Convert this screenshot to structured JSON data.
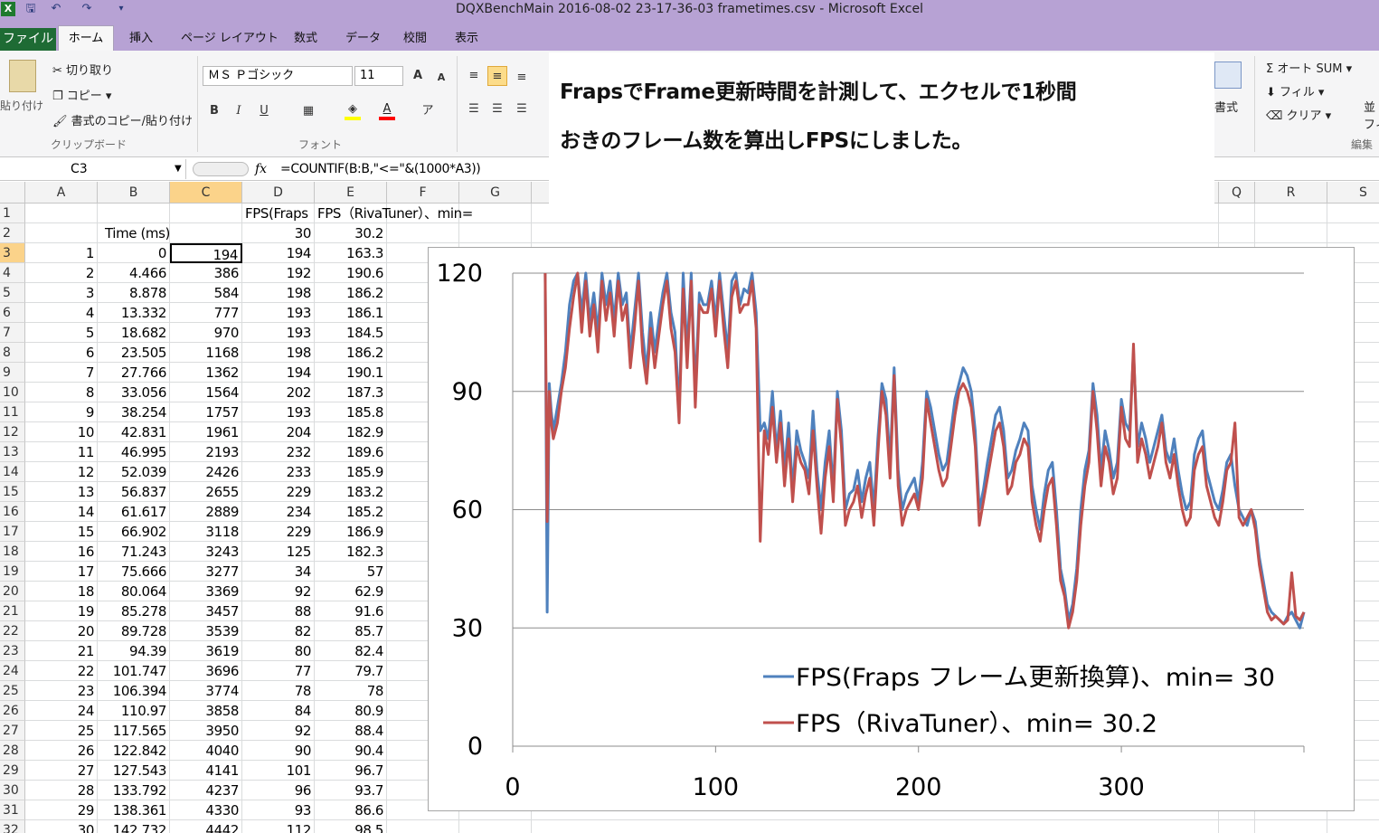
{
  "window": {
    "title": "DQXBenchMain 2016-08-02 23-17-36-03 frametimes.csv - Microsoft Excel"
  },
  "quick_access": {
    "app_icon": "X",
    "save_icon": "save-icon",
    "undo_icon": "undo-icon",
    "redo_icon": "redo-icon",
    "customize_icon": "dropdown-icon"
  },
  "tabs": {
    "file": "ファイル",
    "home": "ホーム",
    "insert": "挿入",
    "page_layout": "ページ レイアウト",
    "formulas": "数式",
    "data": "データ",
    "review": "校閲",
    "view": "表示"
  },
  "clipboard": {
    "paste": "貼り付け",
    "cut": "切り取り",
    "copy": "コピー ▾",
    "format_painter": "書式のコピー/貼り付け",
    "group": "クリップボード"
  },
  "font": {
    "name": "ＭＳ Ｐゴシック",
    "size": "11",
    "group": "フォント",
    "bold": "B",
    "italic": "I",
    "underline": "U",
    "grow": "A",
    "shrink": "A",
    "fill_color": "#ffff00",
    "font_color": "#ff0000"
  },
  "right_ribbon": {
    "autosum": "Σ オート SUM ▾",
    "fill": "フィル ▾",
    "clear": "クリア ▾",
    "group": "編集",
    "styles": "書式",
    "sort1": "並",
    "sort2": "フィ"
  },
  "formula_bar": {
    "name_box": "C3",
    "fx": "fx",
    "formula": "=COUNTIF(B:B,\"<=\"&(1000*A3))"
  },
  "note": {
    "line1": "FrapsでFrame更新時間を計測して、エクセルで1秒間",
    "line2": "おきのフレーム数を算出しFPSにしました。"
  },
  "columns": [
    "A",
    "B",
    "C",
    "D",
    "E",
    "F",
    "G",
    "Q",
    "R",
    "S"
  ],
  "header_row": {
    "r1": {
      "D": "FPS(Fraps",
      "E": "FPS（RivaTuner）、min="
    },
    "r2": {
      "B": "Time (ms)",
      "D": "30",
      "E": "30.2"
    }
  },
  "rows": [
    {
      "n": "3",
      "A": "1",
      "B": "0",
      "C": "194",
      "D": "194",
      "E": "163.3"
    },
    {
      "n": "4",
      "A": "2",
      "B": "4.466",
      "C": "386",
      "D": "192",
      "E": "190.6"
    },
    {
      "n": "5",
      "A": "3",
      "B": "8.878",
      "C": "584",
      "D": "198",
      "E": "186.2"
    },
    {
      "n": "6",
      "A": "4",
      "B": "13.332",
      "C": "777",
      "D": "193",
      "E": "186.1"
    },
    {
      "n": "7",
      "A": "5",
      "B": "18.682",
      "C": "970",
      "D": "193",
      "E": "184.5"
    },
    {
      "n": "8",
      "A": "6",
      "B": "23.505",
      "C": "1168",
      "D": "198",
      "E": "186.2"
    },
    {
      "n": "9",
      "A": "7",
      "B": "27.766",
      "C": "1362",
      "D": "194",
      "E": "190.1"
    },
    {
      "n": "10",
      "A": "8",
      "B": "33.056",
      "C": "1564",
      "D": "202",
      "E": "187.3"
    },
    {
      "n": "11",
      "A": "9",
      "B": "38.254",
      "C": "1757",
      "D": "193",
      "E": "185.8"
    },
    {
      "n": "12",
      "A": "10",
      "B": "42.831",
      "C": "1961",
      "D": "204",
      "E": "182.9"
    },
    {
      "n": "13",
      "A": "11",
      "B": "46.995",
      "C": "2193",
      "D": "232",
      "E": "189.6"
    },
    {
      "n": "14",
      "A": "12",
      "B": "52.039",
      "C": "2426",
      "D": "233",
      "E": "185.9"
    },
    {
      "n": "15",
      "A": "13",
      "B": "56.837",
      "C": "2655",
      "D": "229",
      "E": "183.2"
    },
    {
      "n": "16",
      "A": "14",
      "B": "61.617",
      "C": "2889",
      "D": "234",
      "E": "185.2"
    },
    {
      "n": "17",
      "A": "15",
      "B": "66.902",
      "C": "3118",
      "D": "229",
      "E": "186.9"
    },
    {
      "n": "18",
      "A": "16",
      "B": "71.243",
      "C": "3243",
      "D": "125",
      "E": "182.3"
    },
    {
      "n": "19",
      "A": "17",
      "B": "75.666",
      "C": "3277",
      "D": "34",
      "E": "57"
    },
    {
      "n": "20",
      "A": "18",
      "B": "80.064",
      "C": "3369",
      "D": "92",
      "E": "62.9"
    },
    {
      "n": "21",
      "A": "19",
      "B": "85.278",
      "C": "3457",
      "D": "88",
      "E": "91.6"
    },
    {
      "n": "22",
      "A": "20",
      "B": "89.728",
      "C": "3539",
      "D": "82",
      "E": "85.7"
    },
    {
      "n": "23",
      "A": "21",
      "B": "94.39",
      "C": "3619",
      "D": "80",
      "E": "82.4"
    },
    {
      "n": "24",
      "A": "22",
      "B": "101.747",
      "C": "3696",
      "D": "77",
      "E": "79.7"
    },
    {
      "n": "25",
      "A": "23",
      "B": "106.394",
      "C": "3774",
      "D": "78",
      "E": "78"
    },
    {
      "n": "26",
      "A": "24",
      "B": "110.97",
      "C": "3858",
      "D": "84",
      "E": "80.9"
    },
    {
      "n": "27",
      "A": "25",
      "B": "117.565",
      "C": "3950",
      "D": "92",
      "E": "88.4"
    },
    {
      "n": "28",
      "A": "26",
      "B": "122.842",
      "C": "4040",
      "D": "90",
      "E": "90.4"
    },
    {
      "n": "29",
      "A": "27",
      "B": "127.543",
      "C": "4141",
      "D": "101",
      "E": "96.7"
    },
    {
      "n": "30",
      "A": "28",
      "B": "133.792",
      "C": "4237",
      "D": "96",
      "E": "93.7"
    },
    {
      "n": "31",
      "A": "29",
      "B": "138.361",
      "C": "4330",
      "D": "93",
      "E": "86.6"
    },
    {
      "n": "32",
      "A": "30",
      "B": "142.732",
      "C": "4442",
      "D": "112",
      "E": "98.5"
    }
  ],
  "chart_data": {
    "type": "line",
    "xlim": [
      0,
      390
    ],
    "ylim": [
      0,
      120
    ],
    "x_ticks": [
      "0",
      "100",
      "200",
      "300"
    ],
    "y_ticks": [
      "0",
      "30",
      "60",
      "90",
      "120"
    ],
    "grid": true,
    "legend_position": "lower-right",
    "series": [
      {
        "name": "FPS(Fraps フレーム更新換算)、min= 30",
        "color": "#4f81bd",
        "x": [
          16,
          17,
          18,
          19,
          20,
          22,
          24,
          26,
          28,
          30,
          32,
          34,
          36,
          38,
          40,
          42,
          44,
          46,
          48,
          50,
          52,
          54,
          56,
          58,
          60,
          62,
          64,
          66,
          68,
          70,
          72,
          74,
          76,
          78,
          80,
          82,
          84,
          86,
          88,
          90,
          92,
          94,
          96,
          98,
          100,
          102,
          104,
          106,
          108,
          110,
          112,
          114,
          116,
          118,
          120,
          122,
          124,
          126,
          128,
          130,
          132,
          134,
          136,
          138,
          140,
          142,
          144,
          146,
          148,
          150,
          152,
          154,
          156,
          158,
          160,
          162,
          164,
          166,
          168,
          170,
          172,
          174,
          176,
          178,
          180,
          182,
          184,
          186,
          188,
          190,
          192,
          194,
          196,
          198,
          200,
          202,
          204,
          206,
          208,
          210,
          212,
          214,
          216,
          218,
          220,
          222,
          224,
          226,
          228,
          230,
          232,
          234,
          236,
          238,
          240,
          242,
          244,
          246,
          248,
          250,
          252,
          254,
          256,
          258,
          260,
          262,
          264,
          266,
          268,
          270,
          272,
          274,
          276,
          278,
          280,
          282,
          284,
          286,
          288,
          290,
          292,
          294,
          296,
          298,
          300,
          302,
          304,
          306,
          308,
          310,
          312,
          314,
          316,
          318,
          320,
          322,
          324,
          326,
          328,
          330,
          332,
          334,
          336,
          338,
          340,
          342,
          344,
          346,
          348,
          350,
          352,
          354,
          356,
          358,
          360,
          362,
          364,
          366,
          368,
          370,
          372,
          374,
          376,
          378,
          380,
          382,
          384,
          386,
          388,
          390
        ],
        "y": [
          120,
          34,
          92,
          85,
          80,
          86,
          92,
          100,
          112,
          118,
          120,
          110,
          120,
          108,
          115,
          105,
          120,
          112,
          118,
          108,
          120,
          112,
          115,
          100,
          110,
          120,
          105,
          95,
          110,
          100,
          108,
          115,
          120,
          110,
          105,
          85,
          120,
          100,
          120,
          90,
          115,
          112,
          112,
          118,
          108,
          120,
          110,
          100,
          118,
          120,
          112,
          116,
          115,
          120,
          110,
          80,
          82,
          78,
          90,
          75,
          85,
          70,
          82,
          65,
          80,
          75,
          72,
          68,
          85,
          70,
          60,
          72,
          80,
          65,
          90,
          80,
          60,
          64,
          65,
          70,
          62,
          68,
          72,
          60,
          78,
          92,
          88,
          72,
          96,
          70,
          60,
          64,
          66,
          68,
          62,
          72,
          90,
          86,
          80,
          74,
          70,
          72,
          80,
          88,
          92,
          96,
          94,
          90,
          80,
          60,
          65,
          72,
          78,
          84,
          86,
          80,
          68,
          70,
          75,
          78,
          82,
          80,
          66,
          60,
          55,
          64,
          70,
          72,
          60,
          45,
          40,
          32,
          36,
          45,
          60,
          70,
          75,
          92,
          84,
          70,
          80,
          75,
          68,
          72,
          88,
          82,
          80,
          100,
          76,
          82,
          78,
          72,
          76,
          80,
          84,
          75,
          72,
          78,
          70,
          64,
          60,
          62,
          74,
          78,
          80,
          70,
          66,
          62,
          60,
          65,
          72,
          74,
          66,
          60,
          58,
          56,
          60,
          57,
          48,
          42,
          36,
          34,
          33,
          32,
          31,
          33,
          34,
          32,
          30,
          34
        ]
      },
      {
        "name": "FPS（RivaTuner）、min= 30.2",
        "color": "#c0504d",
        "x": [
          16,
          17,
          18,
          19,
          20,
          22,
          24,
          26,
          28,
          30,
          32,
          34,
          36,
          38,
          40,
          42,
          44,
          46,
          48,
          50,
          52,
          54,
          56,
          58,
          60,
          62,
          64,
          66,
          68,
          70,
          72,
          74,
          76,
          78,
          80,
          82,
          84,
          86,
          88,
          90,
          92,
          94,
          96,
          98,
          100,
          102,
          104,
          106,
          108,
          110,
          112,
          114,
          116,
          118,
          120,
          122,
          124,
          126,
          128,
          130,
          132,
          134,
          136,
          138,
          140,
          142,
          144,
          146,
          148,
          150,
          152,
          154,
          156,
          158,
          160,
          162,
          164,
          166,
          168,
          170,
          172,
          174,
          176,
          178,
          180,
          182,
          184,
          186,
          188,
          190,
          192,
          194,
          196,
          198,
          200,
          202,
          204,
          206,
          208,
          210,
          212,
          214,
          216,
          218,
          220,
          222,
          224,
          226,
          228,
          230,
          232,
          234,
          236,
          238,
          240,
          242,
          244,
          246,
          248,
          250,
          252,
          254,
          256,
          258,
          260,
          262,
          264,
          266,
          268,
          270,
          272,
          274,
          276,
          278,
          280,
          282,
          284,
          286,
          288,
          290,
          292,
          294,
          296,
          298,
          300,
          302,
          304,
          306,
          308,
          310,
          312,
          314,
          316,
          318,
          320,
          322,
          324,
          326,
          328,
          330,
          332,
          334,
          336,
          338,
          340,
          342,
          344,
          346,
          348,
          350,
          352,
          354,
          356,
          358,
          360,
          362,
          364,
          366,
          368,
          370,
          372,
          374,
          376,
          378,
          380,
          382,
          384,
          386,
          388,
          390
        ],
        "y": [
          120,
          57,
          90,
          82,
          78,
          82,
          90,
          96,
          106,
          114,
          120,
          105,
          118,
          104,
          112,
          100,
          118,
          108,
          115,
          104,
          118,
          108,
          112,
          96,
          106,
          118,
          100,
          92,
          106,
          96,
          104,
          112,
          118,
          106,
          100,
          82,
          116,
          96,
          118,
          86,
          112,
          110,
          110,
          116,
          104,
          118,
          106,
          96,
          114,
          118,
          110,
          112,
          112,
          118,
          106,
          52,
          80,
          74,
          86,
          72,
          82,
          66,
          78,
          62,
          76,
          72,
          70,
          64,
          80,
          66,
          54,
          68,
          76,
          62,
          88,
          76,
          56,
          60,
          62,
          66,
          58,
          64,
          68,
          56,
          74,
          90,
          84,
          68,
          94,
          66,
          56,
          60,
          62,
          64,
          60,
          68,
          88,
          82,
          76,
          70,
          66,
          68,
          76,
          84,
          90,
          92,
          90,
          86,
          76,
          56,
          62,
          68,
          74,
          80,
          82,
          76,
          64,
          66,
          72,
          74,
          78,
          76,
          62,
          56,
          52,
          60,
          66,
          68,
          56,
          42,
          38,
          30,
          34,
          42,
          56,
          66,
          72,
          90,
          80,
          66,
          76,
          72,
          64,
          68,
          86,
          78,
          76,
          102,
          72,
          78,
          74,
          68,
          72,
          76,
          82,
          72,
          68,
          74,
          66,
          60,
          56,
          58,
          70,
          74,
          76,
          66,
          62,
          58,
          56,
          62,
          70,
          72,
          82,
          58,
          56,
          58,
          60,
          55,
          46,
          40,
          34,
          32,
          33,
          32,
          31,
          32,
          44,
          33,
          32,
          34
        ]
      }
    ]
  }
}
